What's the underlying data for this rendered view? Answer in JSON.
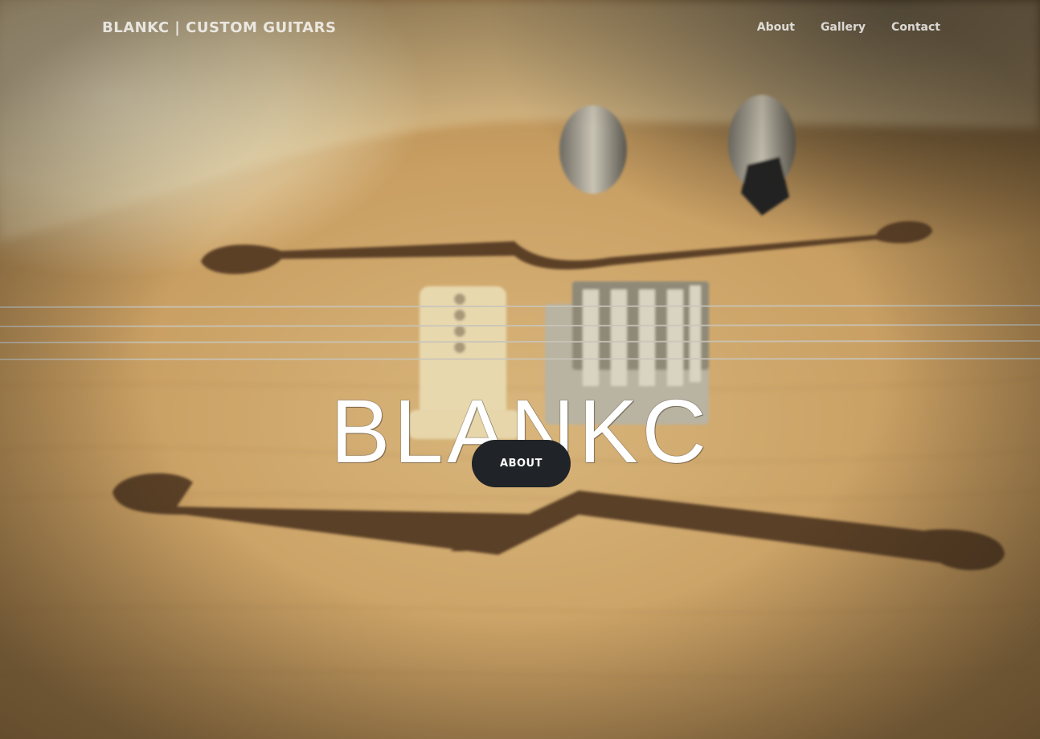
{
  "navbar": {
    "brand": "BLANKC | CUSTOM GUITARS",
    "links": [
      {
        "label": "About"
      },
      {
        "label": "Gallery"
      },
      {
        "label": "Contact"
      }
    ]
  },
  "hero": {
    "headline": "BLANKC",
    "button_label": "ABOUT",
    "background_image": "guitar-body-closeup",
    "button_color": "#202327"
  }
}
